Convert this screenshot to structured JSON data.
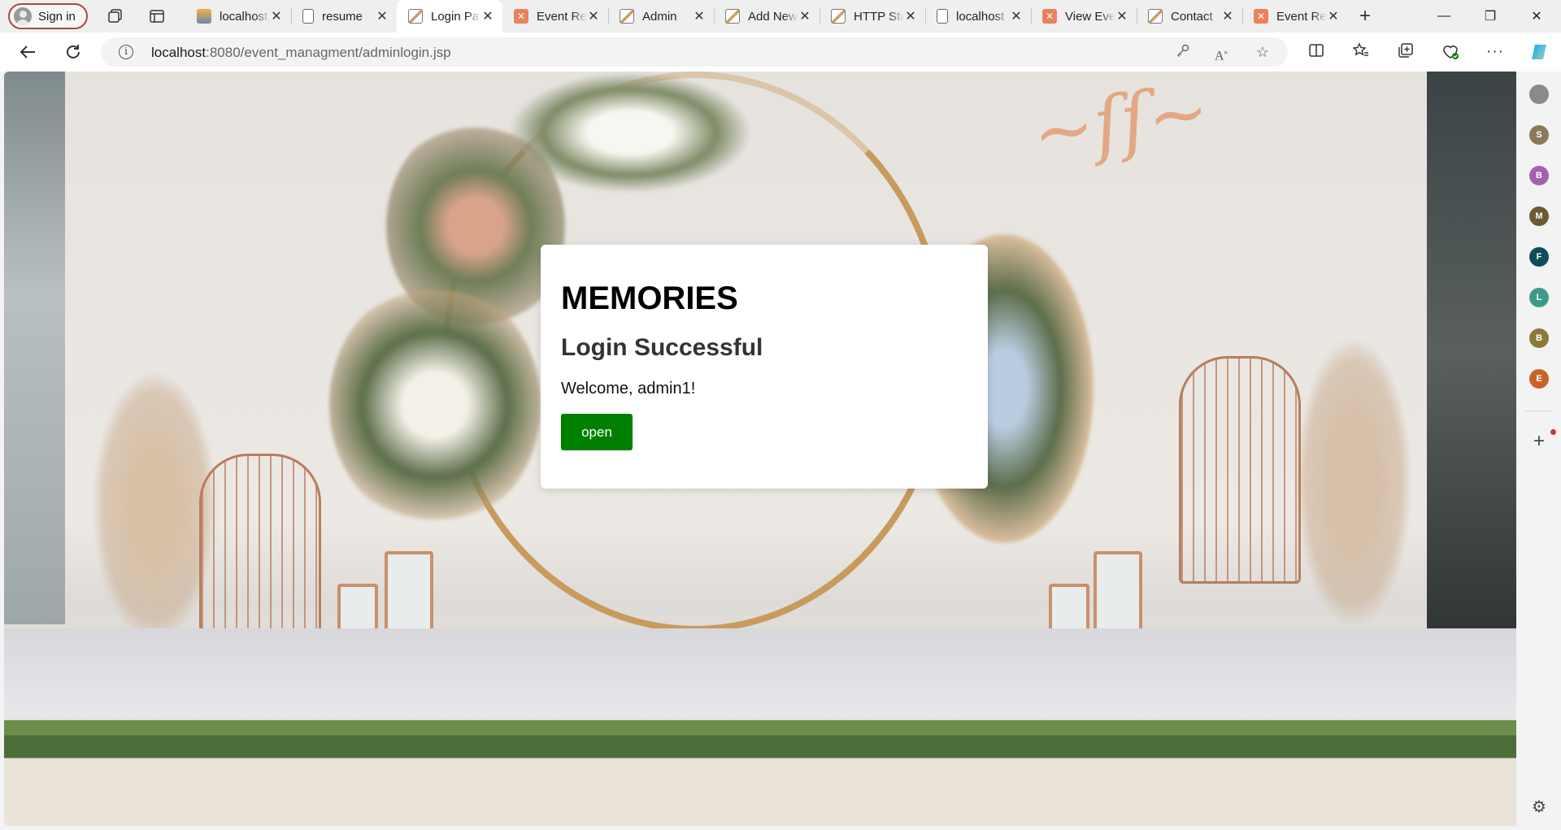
{
  "browser": {
    "profile_label": "Sign in",
    "tabs": [
      {
        "title": "localhost",
        "favicon": "phpmyadmin-icon",
        "active": false
      },
      {
        "title": "resume",
        "favicon": "document-icon",
        "active": false
      },
      {
        "title": "Login Page",
        "favicon": "image-icon",
        "active": true
      },
      {
        "title": "Event Registration",
        "favicon": "xampp-icon",
        "active": false
      },
      {
        "title": "Admin",
        "favicon": "image-icon",
        "active": false
      },
      {
        "title": "Add New",
        "favicon": "image-icon",
        "active": false
      },
      {
        "title": "HTTP Status",
        "favicon": "image-icon",
        "active": false
      },
      {
        "title": "localhost",
        "favicon": "document-icon",
        "active": false
      },
      {
        "title": "View Events",
        "favicon": "xampp-icon",
        "active": false
      },
      {
        "title": "Contact",
        "favicon": "image-icon",
        "active": false
      },
      {
        "title": "Event Registration",
        "favicon": "xampp-icon",
        "active": false
      }
    ],
    "tab_close_glyph": "✕",
    "new_tab_glyph": "+",
    "window_controls": {
      "minimize": "—",
      "restore": "❐",
      "close": "✕"
    },
    "address": {
      "host": "localhost",
      "path": ":8080/event_managment/adminlogin.jsp"
    }
  },
  "page": {
    "heading": "MEMORIES",
    "subheading": "Login Successful",
    "message": "Welcome, admin1!",
    "button_label": "open",
    "button_color": "#008000"
  },
  "sidebar": {
    "items": [
      {
        "letter": "",
        "color": "#8a8a8a"
      },
      {
        "letter": "S",
        "color": "#8a7a5a"
      },
      {
        "letter": "B",
        "color": "#a561b0"
      },
      {
        "letter": "M",
        "color": "#6b5a32"
      },
      {
        "letter": "F",
        "color": "#0e4d5a"
      },
      {
        "letter": "L",
        "color": "#3f9a8c"
      },
      {
        "letter": "B",
        "color": "#8a7a3a"
      },
      {
        "letter": "E",
        "color": "#c8642a"
      }
    ]
  }
}
